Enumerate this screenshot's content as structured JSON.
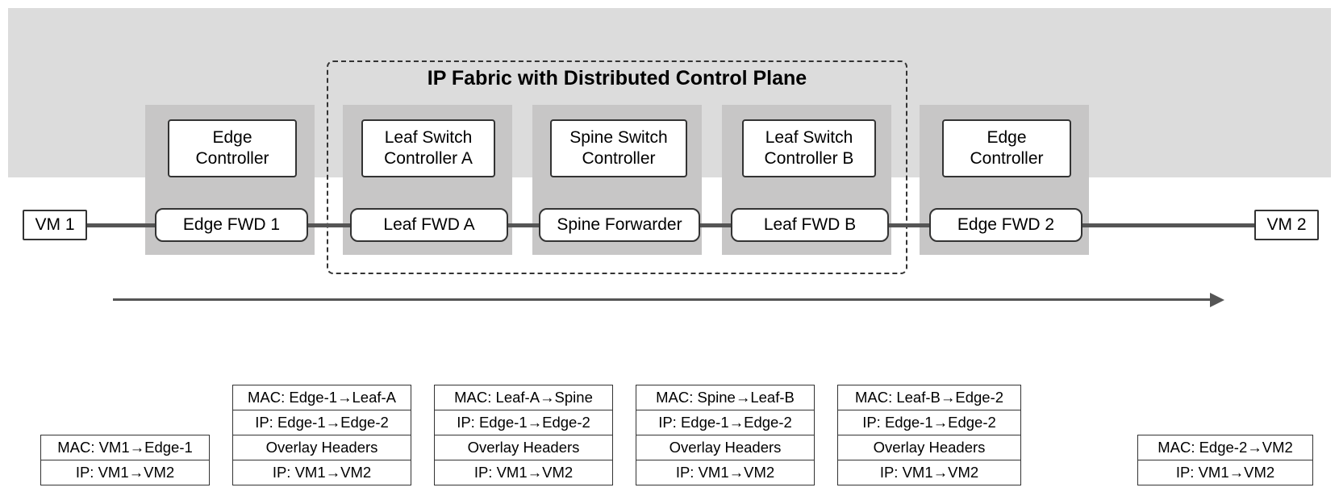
{
  "sn": {
    "s": "S",
    "n": "N"
  },
  "fabric_title": "IP Fabric with Distributed Control Plane",
  "nodes": {
    "vm1": "VM 1",
    "vm2": "VM 2",
    "edge1_ctl": "Edge Controller",
    "edge2_ctl": "Edge Controller",
    "edge1_fwd": "Edge FWD 1",
    "edge2_fwd": "Edge FWD 2",
    "leafA_ctl": "Leaf Switch Controller A",
    "leafB_ctl": "Leaf Switch Controller B",
    "spine_ctl": "Spine Switch Controller",
    "leafA_fwd": "Leaf FWD A",
    "leafB_fwd": "Leaf FWD B",
    "spine_fwd": "Spine Forwarder"
  },
  "packets": [
    {
      "id": "p0",
      "rows": [
        "MAC: VM1→Edge-1",
        "IP: VM1→VM2"
      ]
    },
    {
      "id": "p1",
      "rows": [
        "MAC: Edge-1→Leaf-A",
        "IP: Edge-1→Edge-2",
        "Overlay Headers",
        "IP: VM1→VM2"
      ]
    },
    {
      "id": "p2",
      "rows": [
        "MAC: Leaf-A→Spine",
        "IP: Edge-1→Edge-2",
        "Overlay Headers",
        "IP: VM1→VM2"
      ]
    },
    {
      "id": "p3",
      "rows": [
        "MAC: Spine→Leaf-B",
        "IP: Edge-1→Edge-2",
        "Overlay Headers",
        "IP: VM1→VM2"
      ]
    },
    {
      "id": "p4",
      "rows": [
        "MAC: Leaf-B→Edge-2",
        "IP: Edge-1→Edge-2",
        "Overlay Headers",
        "IP: VM1→VM2"
      ]
    },
    {
      "id": "p5",
      "rows": [
        "MAC: Edge-2→VM2",
        "IP: VM1→VM2"
      ]
    }
  ]
}
